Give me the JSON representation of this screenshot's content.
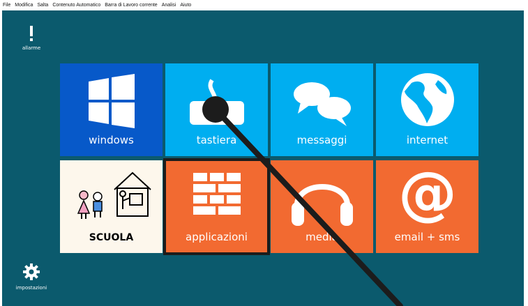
{
  "menubar": {
    "items": [
      "File",
      "Modifica",
      "Salta",
      "Contenuto Automatico",
      "Barra di Lavoro corrente",
      "Analisi",
      "Aiuto"
    ]
  },
  "side": {
    "alarm": {
      "label": "allarme",
      "icon": "exclamation-icon"
    },
    "settings": {
      "label": "impostazioni",
      "icon": "gear-icon"
    }
  },
  "tiles": [
    {
      "label": "windows",
      "icon": "windows-logo-icon",
      "color": "#0759c9"
    },
    {
      "label": "tastiera",
      "icon": "keyboard-icon",
      "color": "#00aef0"
    },
    {
      "label": "messaggi",
      "icon": "speech-bubbles-icon",
      "color": "#00aef0"
    },
    {
      "label": "internet",
      "icon": "globe-icon",
      "color": "#00aef0"
    },
    {
      "label": "SCUOLA",
      "icon": "school-pictogram-icon",
      "color": "#fdf7ec"
    },
    {
      "label": "applicazioni",
      "icon": "apps-grid-icon",
      "color": "#f26a31"
    },
    {
      "label": "media",
      "icon": "headphones-icon",
      "color": "#f26a31"
    },
    {
      "label": "email + sms",
      "icon": "at-sign-icon",
      "color": "#f26a31"
    }
  ],
  "colors": {
    "background": "#0b5a6d",
    "selection_outline": "#1c1c1c",
    "pointer": "#1c1c1c"
  },
  "selected_tile": "applicazioni"
}
